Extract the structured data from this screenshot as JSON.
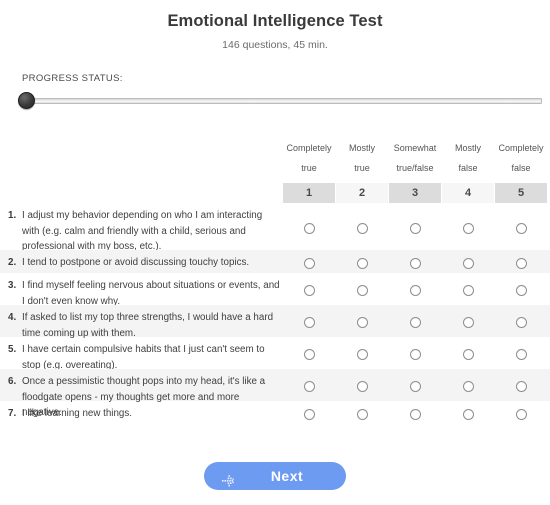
{
  "header": {
    "title": "Emotional Intelligence Test",
    "subtitle": "146 questions, 45 min."
  },
  "progress": {
    "label": "PROGRESS STATUS:",
    "value": 0
  },
  "scale": {
    "columns": [
      {
        "line1": "Completely",
        "line2": "true",
        "number": "1"
      },
      {
        "line1": "Mostly",
        "line2": "true",
        "number": "2"
      },
      {
        "line1": "Somewhat",
        "line2": "true/false",
        "number": "3"
      },
      {
        "line1": "Mostly",
        "line2": "false",
        "number": "4"
      },
      {
        "line1": "Completely",
        "line2": "false",
        "number": "5"
      }
    ]
  },
  "questions": [
    {
      "number": "1.",
      "text": "I adjust my behavior depending on who I am interacting with (e.g. calm and friendly with a child, serious and professional with my boss, etc.)."
    },
    {
      "number": "2.",
      "text": "I tend to postpone or avoid discussing touchy topics."
    },
    {
      "number": "3.",
      "text": "I find myself feeling nervous about situations or events, and I don't even know why."
    },
    {
      "number": "4.",
      "text": "If asked to list my top three strengths, I would have a hard time coming up with them."
    },
    {
      "number": "5.",
      "text": "I have certain compulsive habits that I just can't seem to stop (e.g. overeating)."
    },
    {
      "number": "6.",
      "text": "Once a pessimistic thought pops into my head, it's like a floodgate opens - my thoughts get more and more negative."
    },
    {
      "number": "7.",
      "text": "I like learning new things."
    }
  ],
  "footer": {
    "next_label": "Next",
    "next_icon": "dotted-arrow-right-icon",
    "next_color": "#6d9bf1"
  }
}
